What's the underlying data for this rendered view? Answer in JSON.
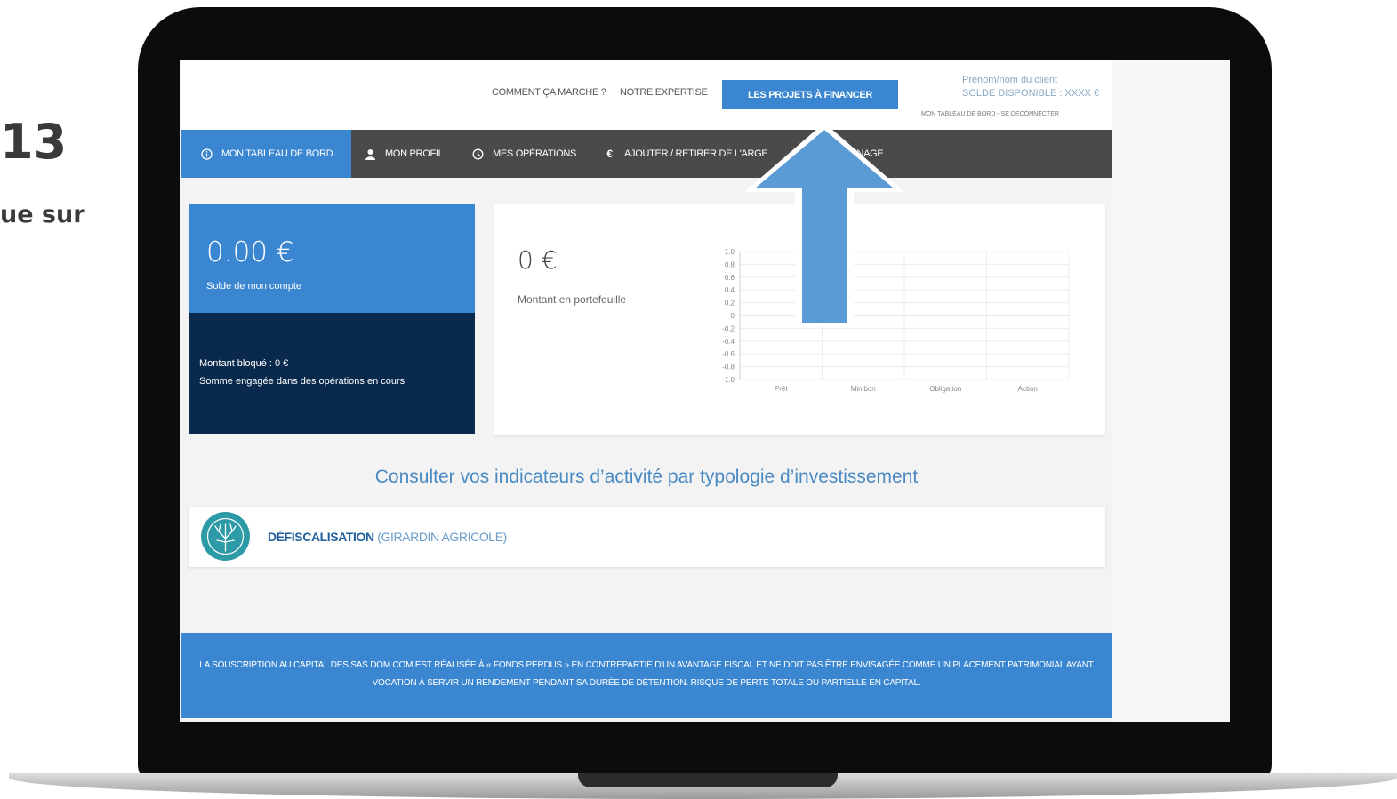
{
  "slide": {
    "step": "13",
    "text": "ue sur"
  },
  "topbar": {
    "link_how": "COMMENT ÇA MARCHE ?",
    "link_expertise": "NOTRE EXPERTISE",
    "cta_label": "LES PROJETS À FINANCER",
    "client_name": "Prénom/nom du client",
    "client_balance": "SOLDE DISPONIBLE : XXXX €",
    "client_links": "MON TABLEAU DE BORD - SE DECONNECTER"
  },
  "nav": {
    "items": [
      {
        "label": "MON TABLEAU DE BORD",
        "icon": "info-icon"
      },
      {
        "label": "MON PROFIL",
        "icon": "user-icon"
      },
      {
        "label": "MES OPÉRATIONS",
        "icon": "history-icon"
      },
      {
        "label": "AJOUTER / RETIRER DE L'ARGE",
        "icon": "euro-icon"
      },
      {
        "label": "RAINAGE",
        "icon": ""
      }
    ]
  },
  "balance": {
    "amount": "0.00 €",
    "label": "Solde de mon compte",
    "blocked": "Montant bloqué : 0 €",
    "engaged": "Somme engagée dans des opérations en cours"
  },
  "portfolio": {
    "amount": "0 €",
    "label": "Montant en portefeuille"
  },
  "chart_data": {
    "type": "bar",
    "categories": [
      "Prêt",
      "Minibon",
      "Obligation",
      "Action"
    ],
    "values": [
      0,
      0,
      0,
      0
    ],
    "y_ticks": [
      "1.0",
      "0.8",
      "0.6",
      "0.4",
      "0.2",
      "0",
      "-0.2",
      "-0.4",
      "-0.6",
      "-0.8",
      "-1.0"
    ],
    "ylim": [
      -1.0,
      1.0
    ],
    "grid": true
  },
  "indicators": {
    "title": "Consulter vos indicateurs d’activité par typologie d’investissement"
  },
  "defisc": {
    "title": "DÉFISCALISATION",
    "subtitle": "(GIRARDIN AGRICOLE)"
  },
  "footer": {
    "text": "LA SOUSCRIPTION AU CAPITAL DES SAS DOM COM EST RÉALISÉE À « FONDS PERDUS » EN CONTREPARTIE D'UN AVANTAGE FISCAL ET NE DOIT PAS ÊTRE ENVISAGÉE COMME UN PLACEMENT PATRIMONIAL AYANT VOCATION À SERVIR UN RENDEMENT PENDANT SA DURÉE DE DÉTENTION. RISQUE DE PERTE TOTALE OU PARTIELLE EN CAPITAL."
  },
  "colors": {
    "accent": "#3a86d0",
    "dark_navy": "#0a2a4d",
    "nav_bg": "#4a4a4a",
    "arrow": "#5b9bd5"
  }
}
